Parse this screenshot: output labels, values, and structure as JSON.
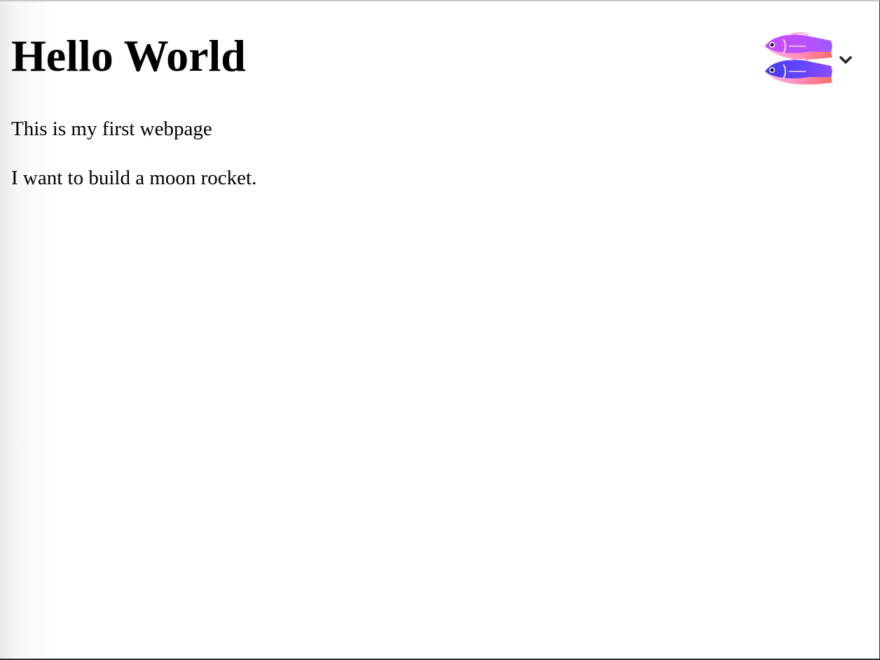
{
  "page": {
    "heading": "Hello World",
    "paragraphs": [
      "This is my first webpage",
      "I want to build a moon rocket."
    ]
  },
  "extension_widget": {
    "logo_icon": "two-fish-logo-icon",
    "menu_icon": "chevron-down-icon"
  },
  "colors": {
    "text": "#000000",
    "background": "#ffffff",
    "fish_gradient_start": "#c84dff",
    "fish_gradient_mid": "#8a4dff",
    "fish_gradient_end": "#ff6b6b",
    "fish_belly": "#ff9fd0",
    "chevron": "#222222"
  }
}
